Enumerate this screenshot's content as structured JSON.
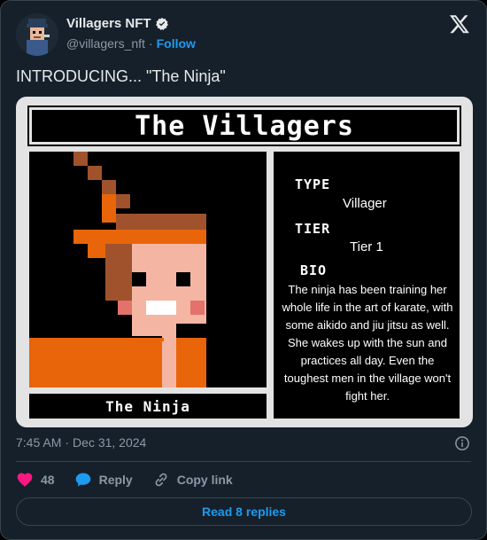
{
  "author": {
    "display_name": "Villagers NFT",
    "handle": "@villagers_nft",
    "separator": "·",
    "follow_label": "Follow"
  },
  "tweet": {
    "text": "INTRODUCING... \"The Ninja\""
  },
  "card": {
    "title": "The Villagers",
    "caption": "The Ninja",
    "type_label": "TYPE",
    "type_value": "Villager",
    "tier_label": "TIER",
    "tier_value": "Tier 1",
    "bio_label": "BIO",
    "bio_text": "The ninja has been training her whole life in the art of karate, with some aikido and jiu jitsu as well. She wakes up with the sun and practices all day. Even the toughest men in the village won't fight her."
  },
  "meta": {
    "time": "7:45 AM",
    "separator": "·",
    "date": "Dec 31, 2024"
  },
  "actions": {
    "like_count": "48",
    "reply_label": "Reply",
    "copy_label": "Copy link"
  },
  "footer": {
    "read_replies_label": "Read 8 replies"
  },
  "icons": {
    "verified": "verified-badge-icon",
    "logo": "x-logo-icon",
    "info": "info-icon",
    "like": "heart-icon",
    "reply": "speech-bubble-icon",
    "copy": "link-icon"
  },
  "colors": {
    "background": "#15202b",
    "accent": "#1d9bf0",
    "like": "#f91880",
    "muted": "#8b98a5",
    "border": "#38444d"
  }
}
